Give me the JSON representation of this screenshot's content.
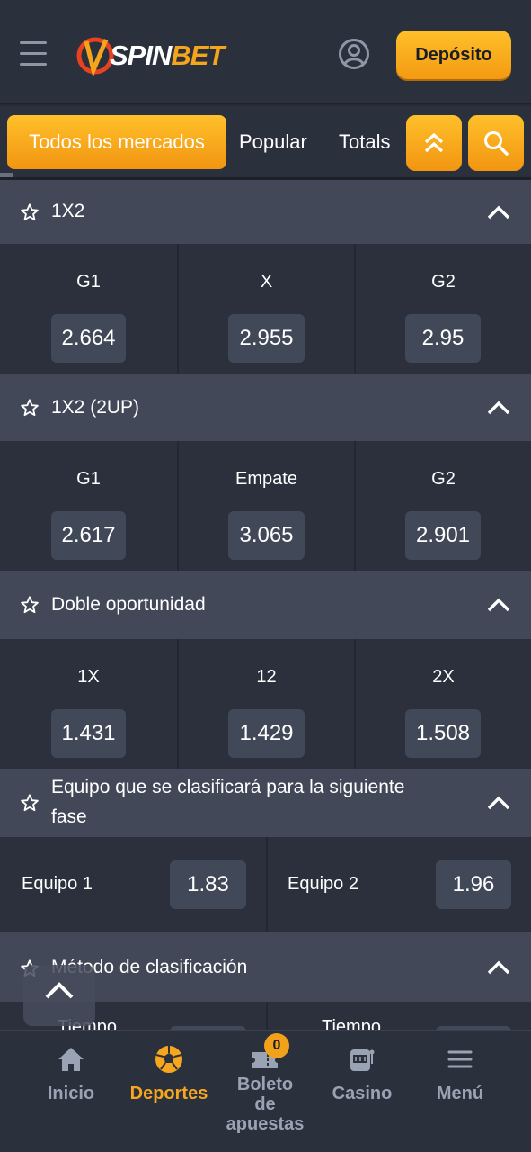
{
  "header": {
    "logo_text_a": "SPIN",
    "logo_text_b": "BET",
    "deposit_label": "Depósito"
  },
  "tabs": {
    "all_markets": "Todos los mercados",
    "popular": "Popular",
    "totals": "Totals"
  },
  "markets": [
    {
      "title": "1X2",
      "outcomes": [
        {
          "label": "G1",
          "odd": "2.664"
        },
        {
          "label": "X",
          "odd": "2.955"
        },
        {
          "label": "G2",
          "odd": "2.95"
        }
      ]
    },
    {
      "title": "1X2 (2UP)",
      "outcomes": [
        {
          "label": "G1",
          "odd": "2.617"
        },
        {
          "label": "Empate",
          "odd": "3.065"
        },
        {
          "label": "G2",
          "odd": "2.901"
        }
      ]
    },
    {
      "title": "Doble oportunidad",
      "outcomes": [
        {
          "label": "1X",
          "odd": "1.431"
        },
        {
          "label": "12",
          "odd": "1.429"
        },
        {
          "label": "2X",
          "odd": "1.508"
        }
      ]
    },
    {
      "title_line1": "Equipo que se clasificará para la siguiente",
      "title_line2": "fase",
      "outcomes": [
        {
          "label": "Equipo 1",
          "odd": "1.83"
        },
        {
          "label": "Equipo 2",
          "odd": "1.96"
        }
      ]
    },
    {
      "title": "Método de clasificación",
      "outcomes": [
        {
          "label": "Tiempo"
        },
        {
          "label": "Tiempo"
        }
      ]
    }
  ],
  "bottom_nav": {
    "home": "Inicio",
    "sports": "Deportes",
    "betslip_l1": "Boleto",
    "betslip_l2": "de",
    "betslip_l3": "apuestas",
    "betslip_count": "0",
    "casino": "Casino",
    "menu": "Menú"
  },
  "colors": {
    "accent": "#f6a71d",
    "header_bg": "#2b303d",
    "market_header_bg": "#424857",
    "odd_btn_bg": "#414857"
  }
}
